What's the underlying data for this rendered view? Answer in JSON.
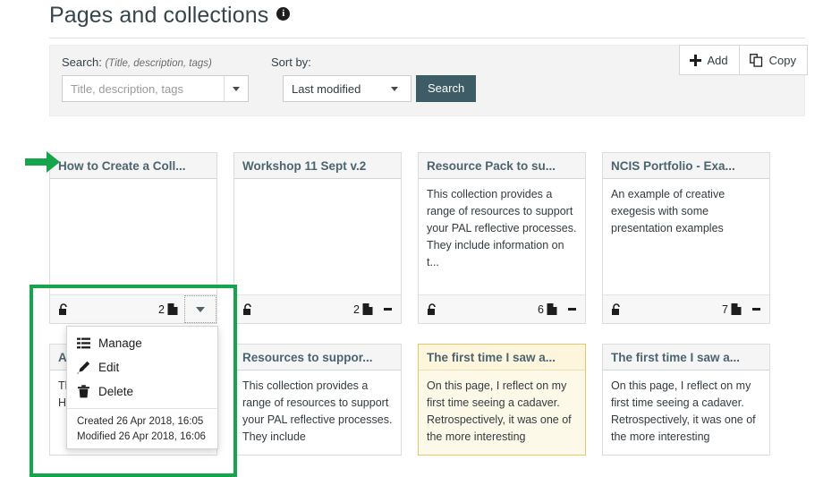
{
  "header": {
    "title": "Pages and collections",
    "info_icon": "info-icon"
  },
  "search_panel": {
    "search_label": "Search:",
    "search_hint": "(Title, description, tags)",
    "search_input_placeholder": "Title, description, tags",
    "search_input_value": "",
    "sort_label": "Sort by:",
    "sort_selected": "Last modified",
    "search_button": "Search",
    "search_button_color": "#3e5c66"
  },
  "actions": {
    "add_label": "Add",
    "add_icon": "plus-icon",
    "copy_label": "Copy",
    "copy_icon": "copy-pages-icon"
  },
  "cards": [
    {
      "title": "How to Create a Coll...",
      "body": "",
      "lock_icon": "unlocked-icon",
      "page_count": "2",
      "menu_style": "chevron",
      "highlight": false
    },
    {
      "title": "Workshop 11 Sept v.2",
      "body": "",
      "lock_icon": "unlocked-icon",
      "page_count": "2",
      "menu_style": "kebab",
      "highlight": false
    },
    {
      "title": "Resource Pack to su...",
      "body": "This collection provides a range of resources to support your PAL reflective processes. They include information on t...",
      "lock_icon": "unlocked-icon",
      "page_count": "6",
      "menu_style": "kebab",
      "highlight": false
    },
    {
      "title": "NCIS Portfolio - Exa...",
      "body": "An example of creative exegesis with some presentation examples",
      "lock_icon": "unlocked-icon",
      "page_count": "7",
      "menu_style": "kebab",
      "highlight": false
    }
  ],
  "cards_row2": [
    {
      "title": "A",
      "body": "Th bo th higher education. Here is",
      "highlight": false
    },
    {
      "title": "Resources to suppor...",
      "body": "This collection provides a range of resources to support your PAL reflective processes. They include",
      "highlight": false
    },
    {
      "title": "The first time I saw a...",
      "body": "On this page, I reflect on my first time seeing a cadaver. Retrospectively, it was one of the more interesting",
      "highlight": true
    },
    {
      "title": "The first time I saw a...",
      "body": "On this page, I reflect on my first time seeing a cadaver. Retrospectively, it was one of the more interesting",
      "highlight": false
    }
  ],
  "dropdown": {
    "items": [
      {
        "label": "Manage",
        "icon": "list-icon"
      },
      {
        "label": "Edit",
        "icon": "pencil-icon"
      },
      {
        "label": "Delete",
        "icon": "trash-icon"
      }
    ],
    "created": "Created 26 Apr 2018, 16:05",
    "modified": "Modified 26 Apr 2018, 16:06"
  },
  "annotations": {
    "highlight_color": "#15a54a",
    "arrow": "right-arrow",
    "box": "highlight-box"
  }
}
